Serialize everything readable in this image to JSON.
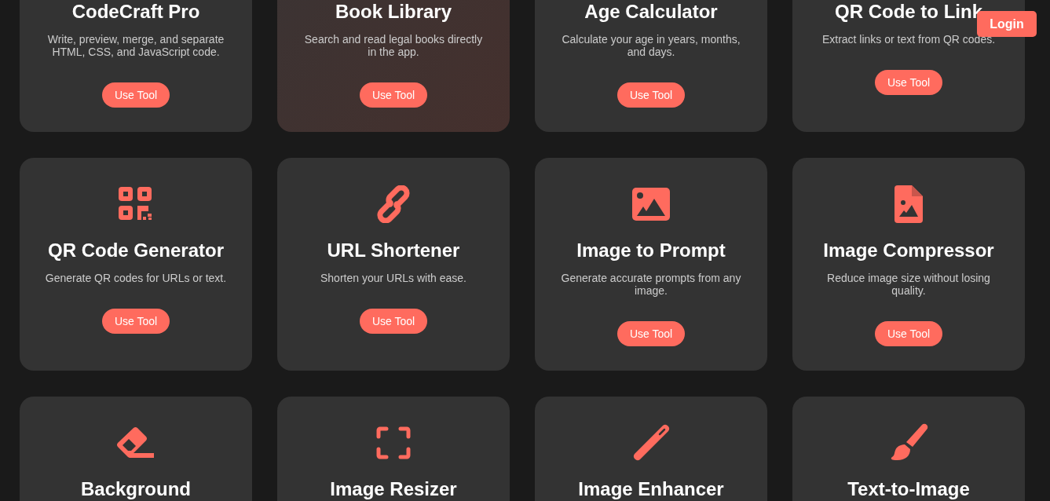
{
  "login_button": {
    "label": "Login"
  },
  "tools": [
    {
      "title": "CodeCraft Pro",
      "description": "Write, preview, merge, and separate HTML, CSS, and JavaScript code.",
      "button": "Use Tool",
      "hovered": false
    },
    {
      "title": "Book Library",
      "description": "Search and read legal books directly in the app.",
      "button": "Use Tool",
      "hovered": true
    },
    {
      "title": "Age Calculator",
      "description": "Calculate your age in years, months, and days.",
      "button": "Use Tool",
      "hovered": false
    },
    {
      "title": "QR Code to Link",
      "description": "Extract links or text from QR codes.",
      "button": "Use Tool",
      "hovered": false
    },
    {
      "kind": "qr",
      "title": "QR Code Generator",
      "description": "Generate QR codes for URLs or text.",
      "button": "Use Tool",
      "hovered": false
    },
    {
      "kind": "link",
      "title": "URL Shortener",
      "description": "Shorten your URLs with ease.",
      "button": "Use Tool",
      "hovered": false
    },
    {
      "kind": "image",
      "title": "Image to Prompt",
      "description": "Generate accurate prompts from any image.",
      "button": "Use Tool",
      "hovered": false
    },
    {
      "kind": "document",
      "title": "Image Compressor",
      "description": "Reduce image size without losing quality.",
      "button": "Use Tool",
      "hovered": false
    },
    {
      "kind": "eraser",
      "title": "Background",
      "hovered": false
    },
    {
      "kind": "frame",
      "title": "Image Resizer",
      "hovered": false
    },
    {
      "kind": "wand",
      "title": "Image Enhancer",
      "hovered": false
    },
    {
      "kind": "brush",
      "title": "Text-to-Image",
      "hovered": false
    }
  ]
}
